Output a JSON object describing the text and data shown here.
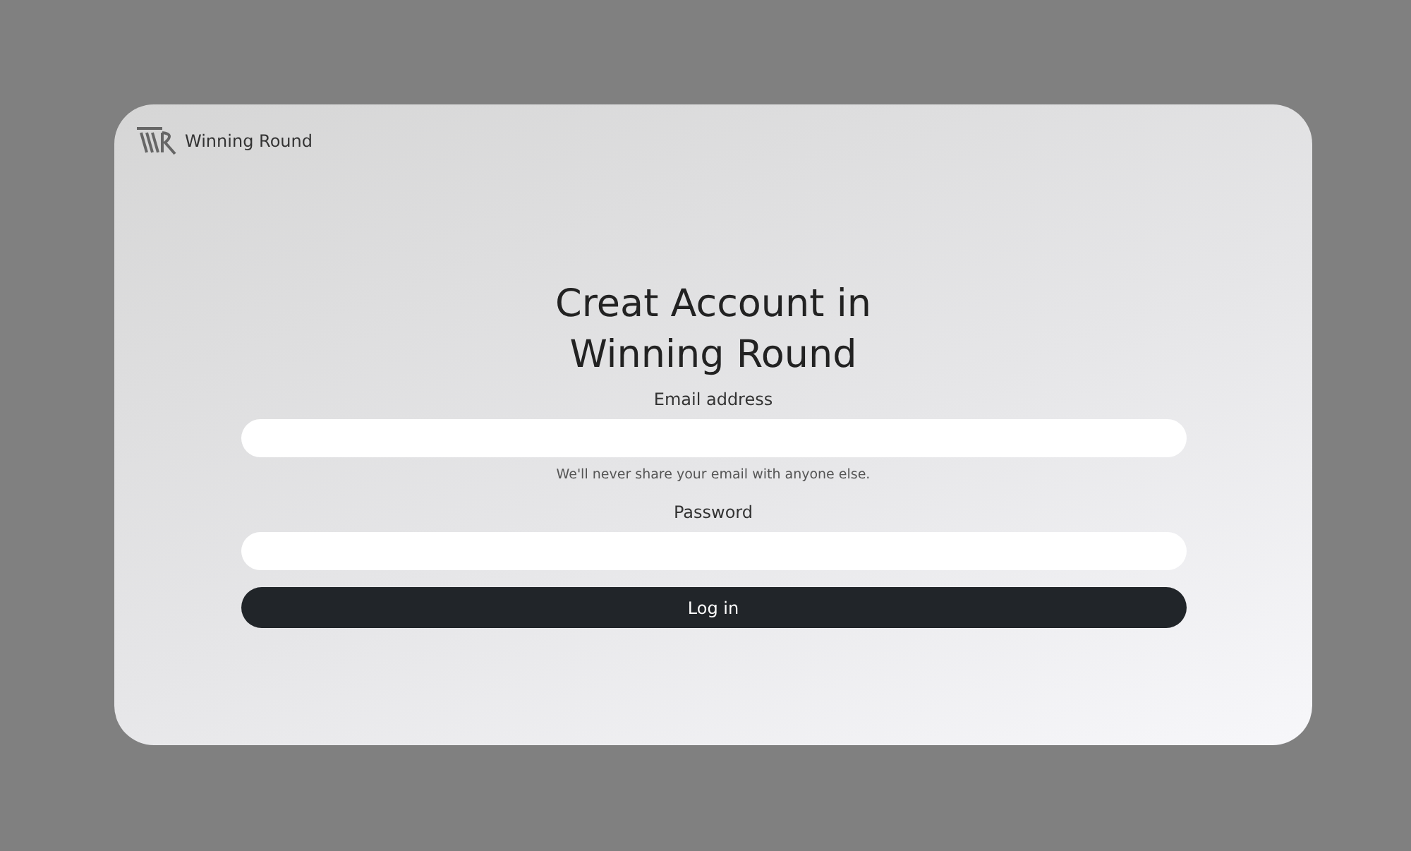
{
  "brand": {
    "name": "Winning Round"
  },
  "heading": {
    "lines": [
      "Creat Account in",
      "Winning Round"
    ]
  },
  "form": {
    "fields": [
      {
        "label": "Email address",
        "help": "We'll never share your email with anyone else."
      },
      {
        "label": "Password"
      }
    ],
    "submit": "Log in"
  }
}
